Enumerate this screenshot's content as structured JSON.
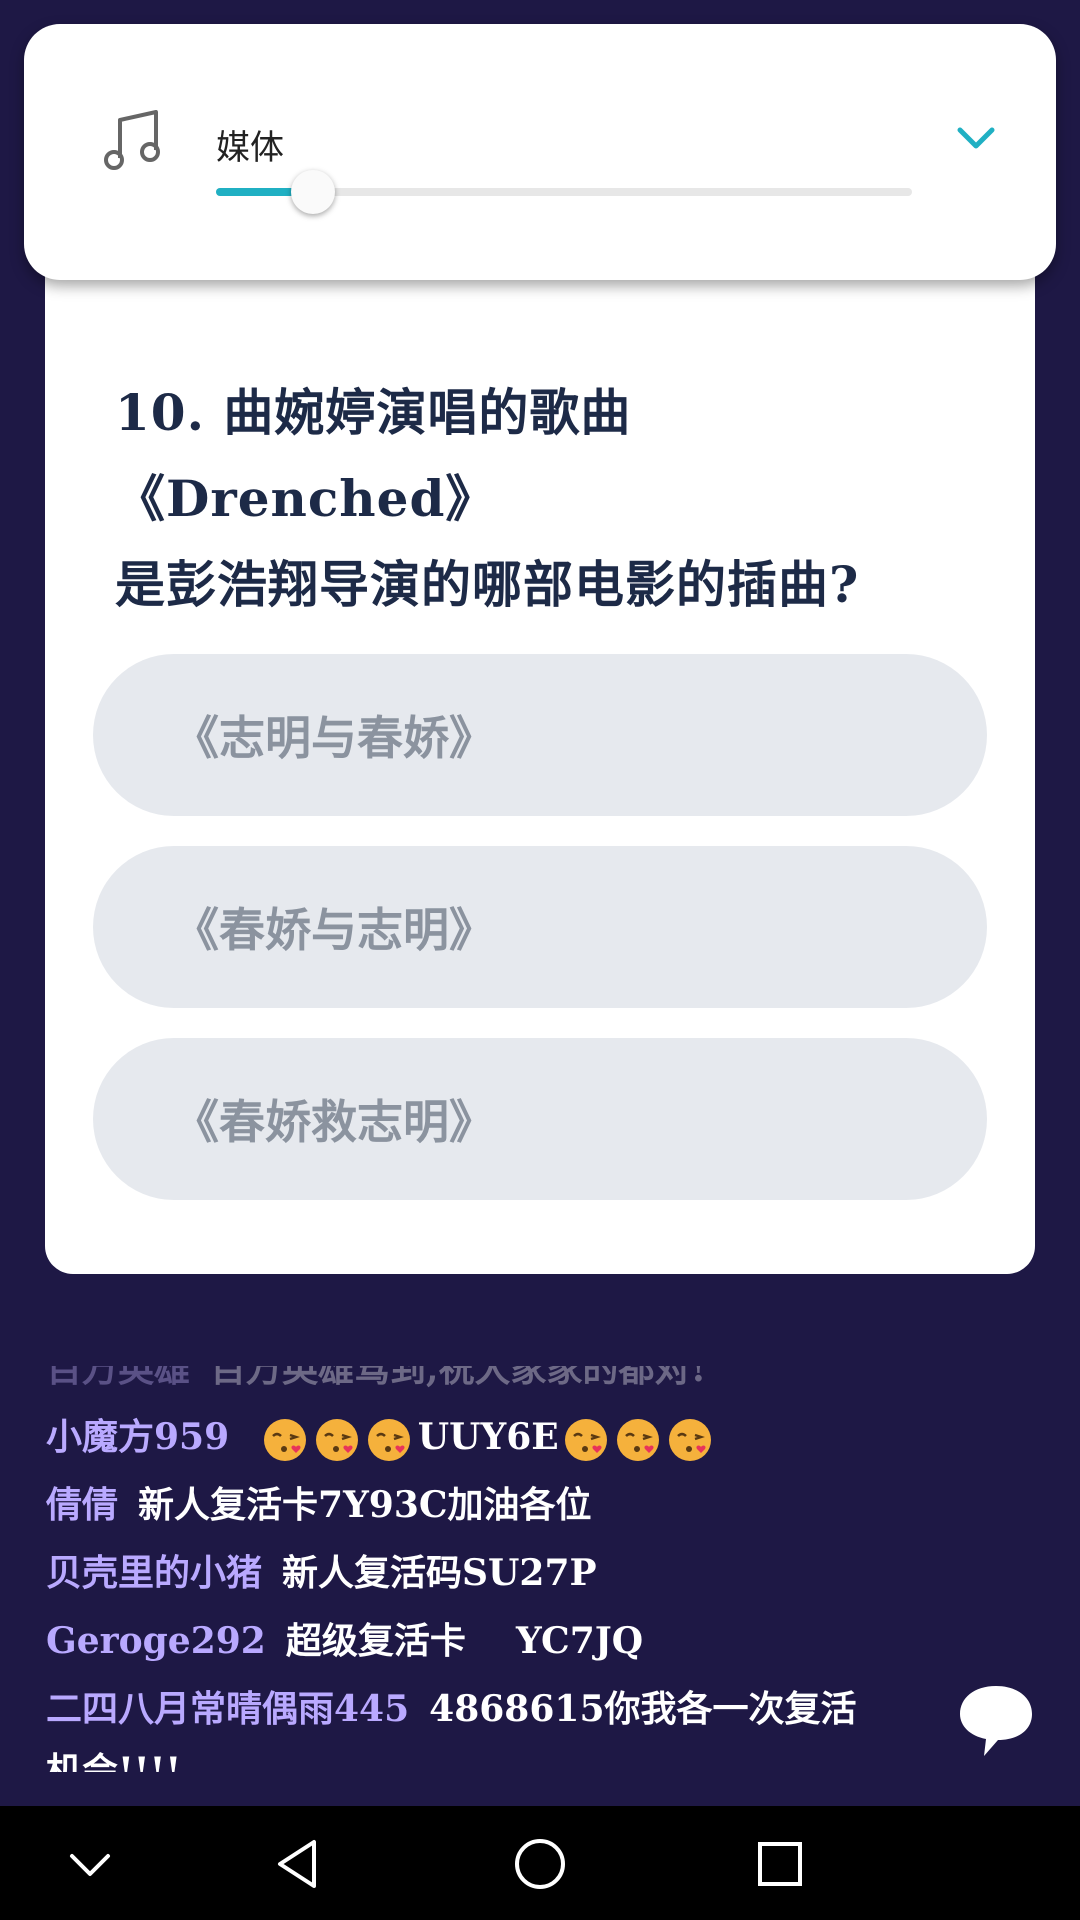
{
  "volume_panel": {
    "label": "媒体",
    "level_percent": 14,
    "accent_color": "#20b0c3",
    "icon": "music-note-icon",
    "collapse_icon": "chevron-down-icon"
  },
  "question": {
    "text_line1": "10. 曲婉婷演唱的歌曲《Drenched》",
    "text_line2": "是彭浩翔导演的哪部电影的插曲?"
  },
  "options": [
    {
      "label": "《志明与春娇》"
    },
    {
      "label": "《春娇与志明》"
    },
    {
      "label": "《春娇救志明》"
    }
  ],
  "comments": [
    {
      "user": "百万英雄",
      "message": "百万英雄驾到,祝大家家的都对!"
    },
    {
      "user": "小魔方959",
      "message": "UUY6E"
    },
    {
      "user": "倩倩",
      "message": "新人复活卡7Y93C加油各位"
    },
    {
      "user": "贝壳里的小猪",
      "message": "新人复活码SU27P"
    },
    {
      "user": "Geroge292",
      "message": "超级复活卡    YC7JQ"
    },
    {
      "user": "二四八月常晴偶雨445",
      "message": "4868615你我各一次复活"
    },
    {
      "user": "",
      "message": "机会!!!!"
    }
  ],
  "chat_icon": "chat-bubble-icon",
  "nav": {
    "icons": [
      "chevron-down-icon",
      "back-icon",
      "home-icon",
      "recents-icon"
    ]
  }
}
